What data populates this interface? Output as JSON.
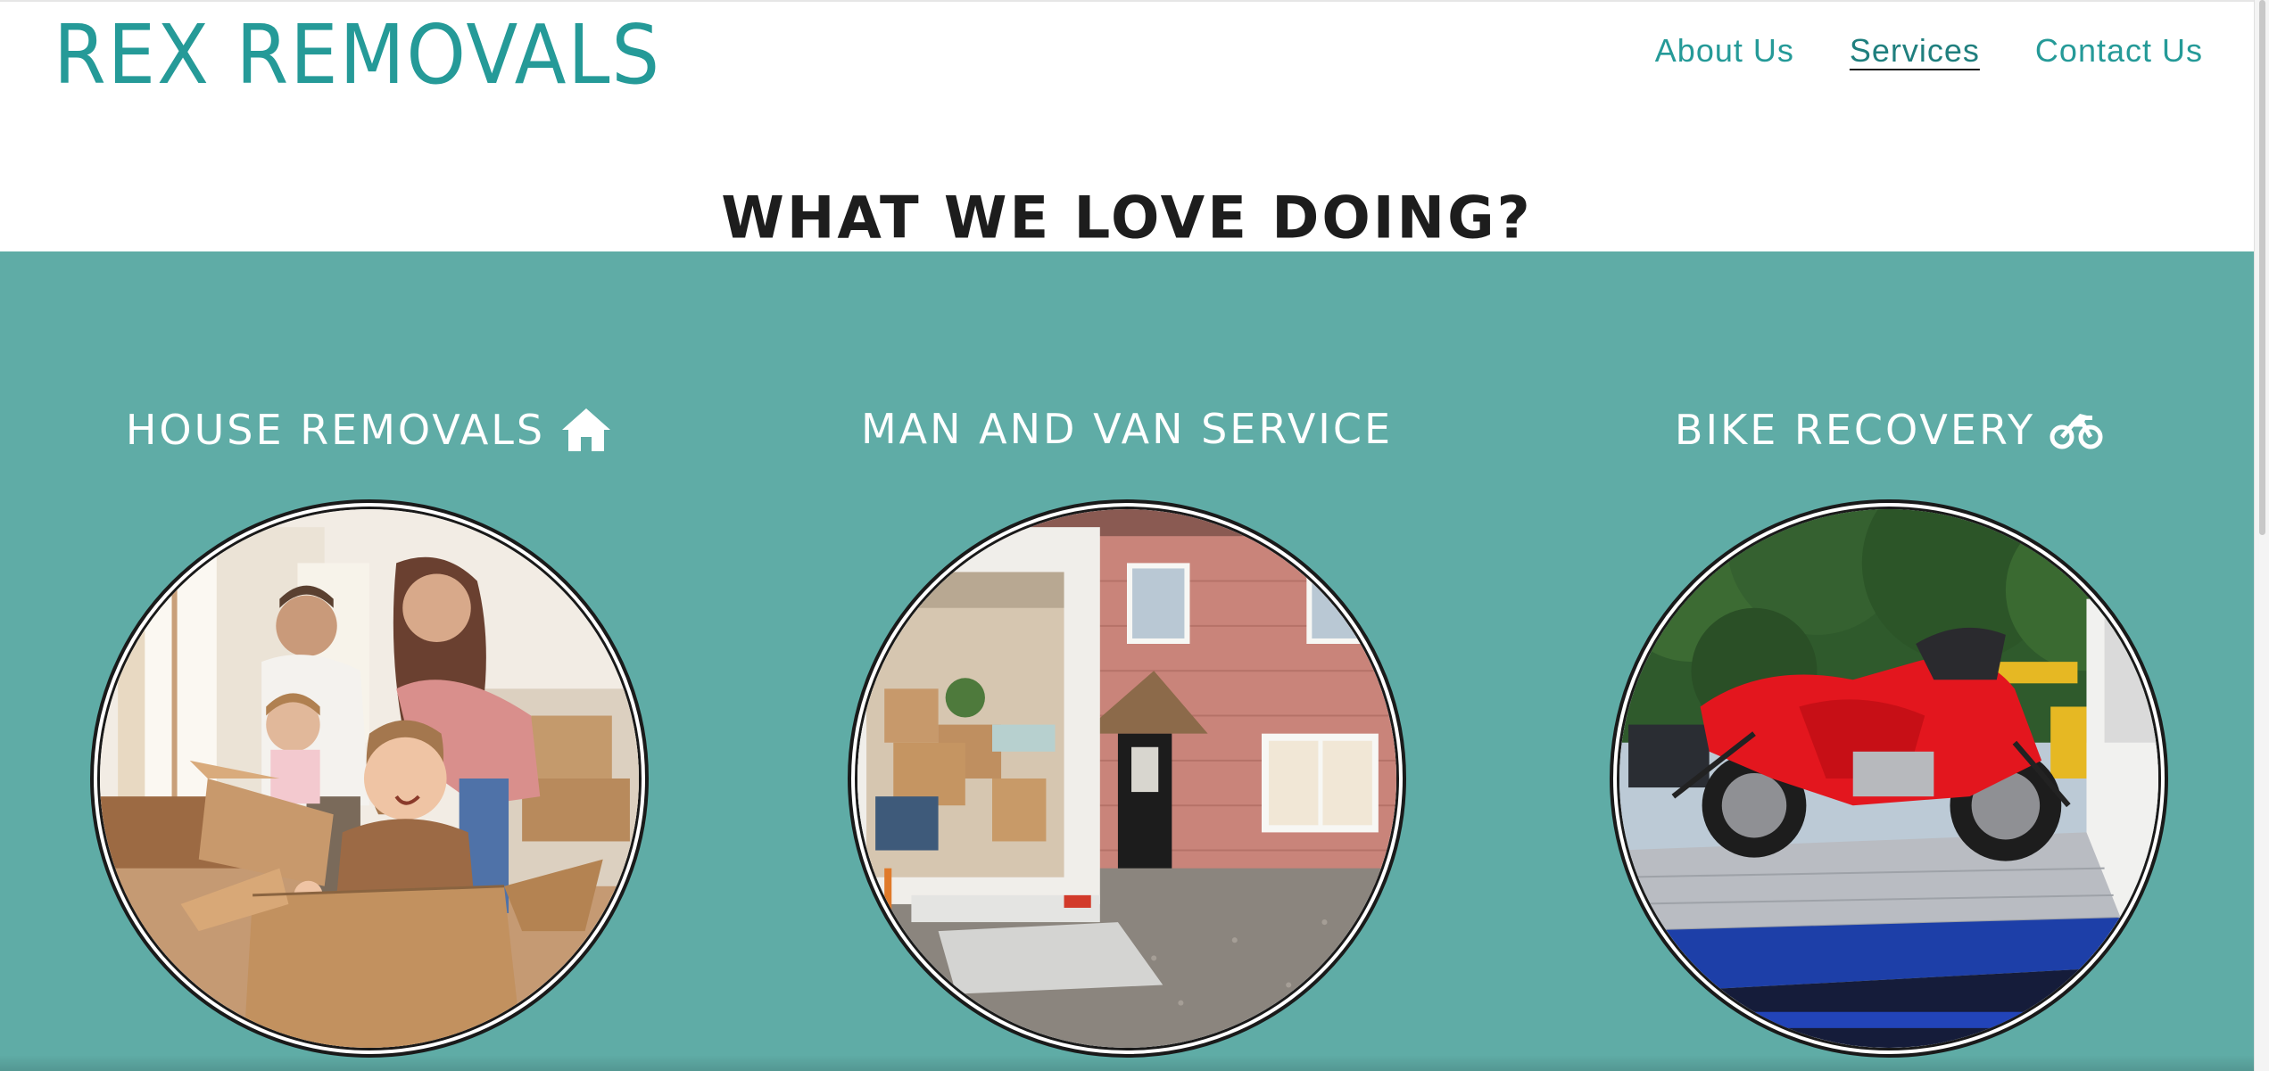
{
  "brand": {
    "name": "REX REMOVALS",
    "color": "#259a98"
  },
  "nav": {
    "items": [
      {
        "label": "About Us",
        "active": false
      },
      {
        "label": "Services",
        "active": true
      },
      {
        "label": "Contact Us",
        "active": false
      }
    ]
  },
  "section": {
    "title": "WHAT WE LOVE DOING?",
    "band_color": "#5faca6"
  },
  "services": [
    {
      "title": "HOUSE REMOVALS",
      "icon": "house-icon",
      "image": "family-playing-in-moving-boxes"
    },
    {
      "title": "MAN AND VAN SERVICE",
      "icon": "",
      "image": "removal-van-outside-brick-house"
    },
    {
      "title": "BIKE RECOVERY",
      "icon": "motorcycle-icon",
      "image": "red-motorcycle-on-recovery-truck"
    }
  ]
}
